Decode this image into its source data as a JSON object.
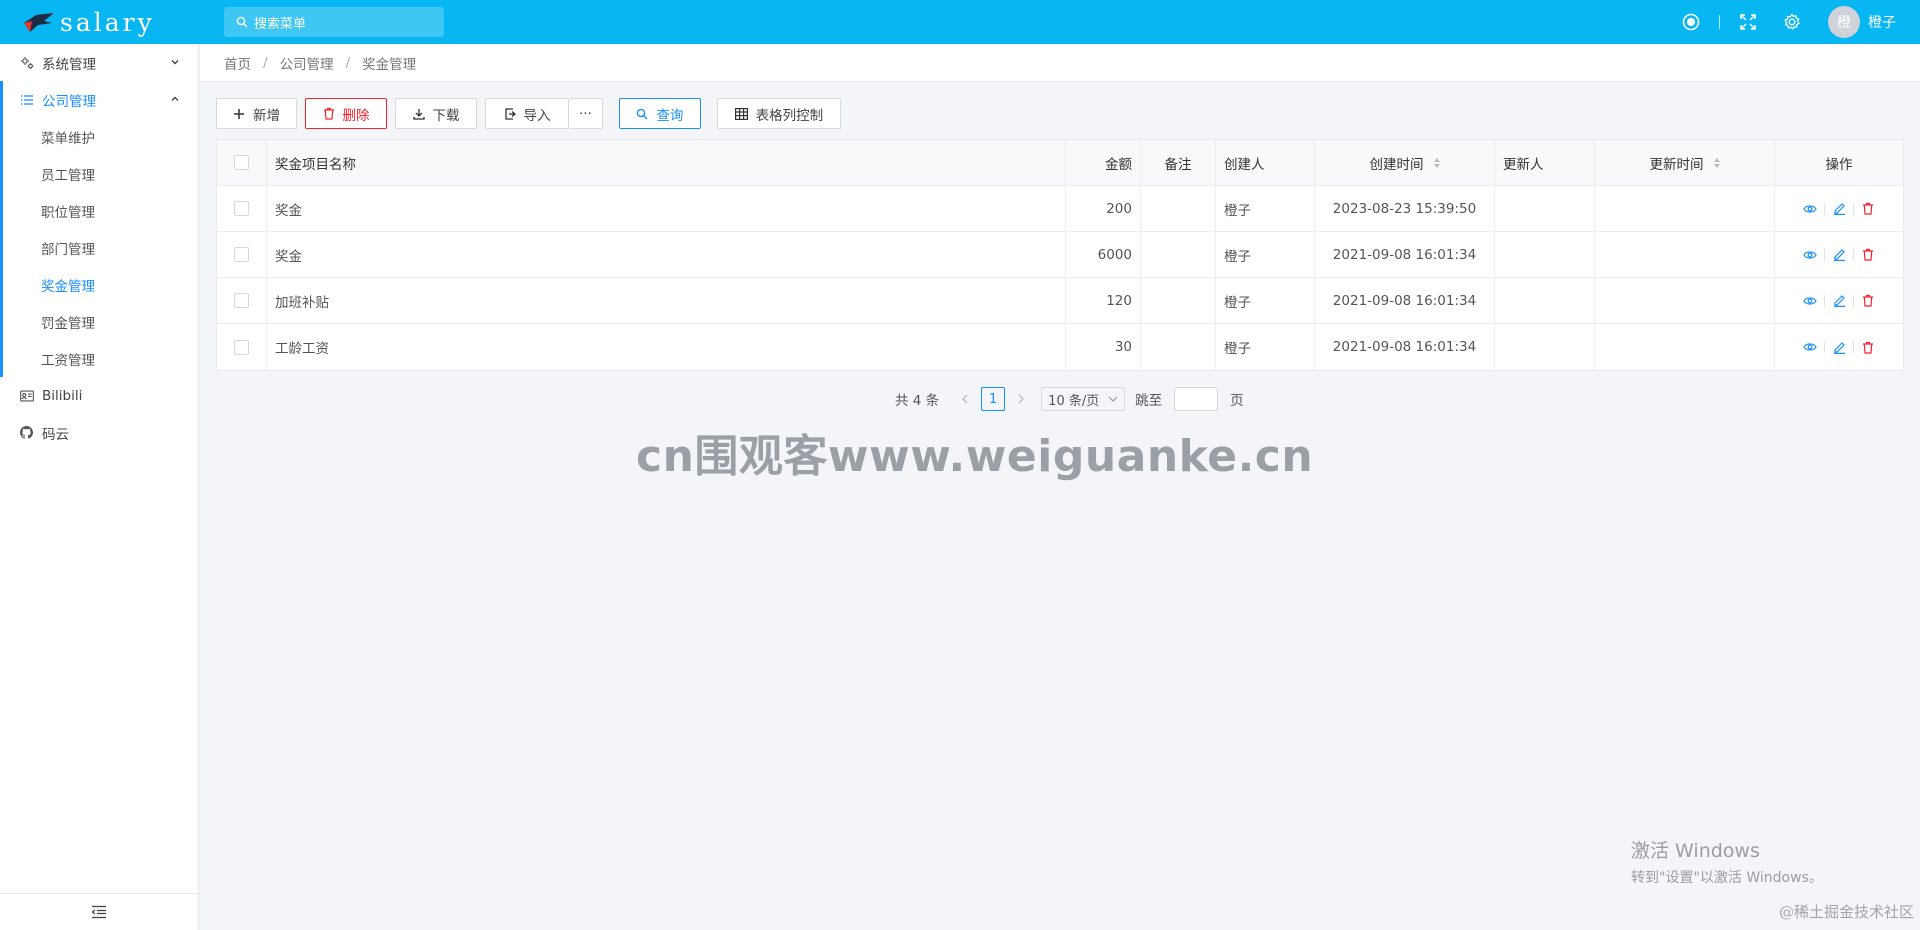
{
  "app": {
    "title": "salary"
  },
  "search": {
    "placeholder": "搜索菜单"
  },
  "header": {
    "username": "橙子",
    "avatar_text": "橙"
  },
  "sidebar": {
    "items": [
      {
        "label": "系统管理",
        "icon": "gears-icon"
      },
      {
        "label": "公司管理",
        "icon": "list-icon"
      },
      {
        "label": "Bilibili",
        "icon": "bilibili-icon"
      },
      {
        "label": "码云",
        "icon": "github-icon"
      }
    ],
    "sub_items": [
      "菜单维护",
      "员工管理",
      "职位管理",
      "部门管理",
      "奖金管理",
      "罚金管理",
      "工资管理"
    ]
  },
  "breadcrumb": {
    "home": "首页",
    "parent": "公司管理",
    "current": "奖金管理"
  },
  "toolbar": {
    "add": "新增",
    "delete": "删除",
    "download": "下载",
    "import": "导入",
    "more": "···",
    "query": "查询",
    "columns": "表格列控制"
  },
  "table": {
    "headers": {
      "name": "奖金项目名称",
      "amount": "金额",
      "note": "备注",
      "creator": "创建人",
      "created_at": "创建时间",
      "updater": "更新人",
      "updated_at": "更新时间",
      "ops": "操作"
    },
    "rows": [
      {
        "name": "奖金",
        "amount": "200",
        "note": "",
        "creator": "橙子",
        "created_at": "2023-08-23 15:39:50",
        "updater": "",
        "updated_at": ""
      },
      {
        "name": "奖金",
        "amount": "6000",
        "note": "",
        "creator": "橙子",
        "created_at": "2021-09-08 16:01:34",
        "updater": "",
        "updated_at": ""
      },
      {
        "name": "加班补贴",
        "amount": "120",
        "note": "",
        "creator": "橙子",
        "created_at": "2021-09-08 16:01:34",
        "updater": "",
        "updated_at": ""
      },
      {
        "name": "工龄工资",
        "amount": "30",
        "note": "",
        "creator": "橙子",
        "created_at": "2021-09-08 16:01:34",
        "updater": "",
        "updated_at": ""
      }
    ]
  },
  "pagination": {
    "total": "共 4 条",
    "current": "1",
    "page_size": "10 条/页",
    "jump_label": "跳至",
    "page_unit": "页"
  },
  "watermarks": {
    "center": "cn围观客www.weiguanke.cn",
    "windows_title": "激活 Windows",
    "windows_sub": "转到\"设置\"以激活 Windows。",
    "juejin": "@稀土掘金技术社区"
  },
  "colors": {
    "header": "#08b6f2",
    "primary": "#1890ff",
    "danger": "#f5222d"
  }
}
